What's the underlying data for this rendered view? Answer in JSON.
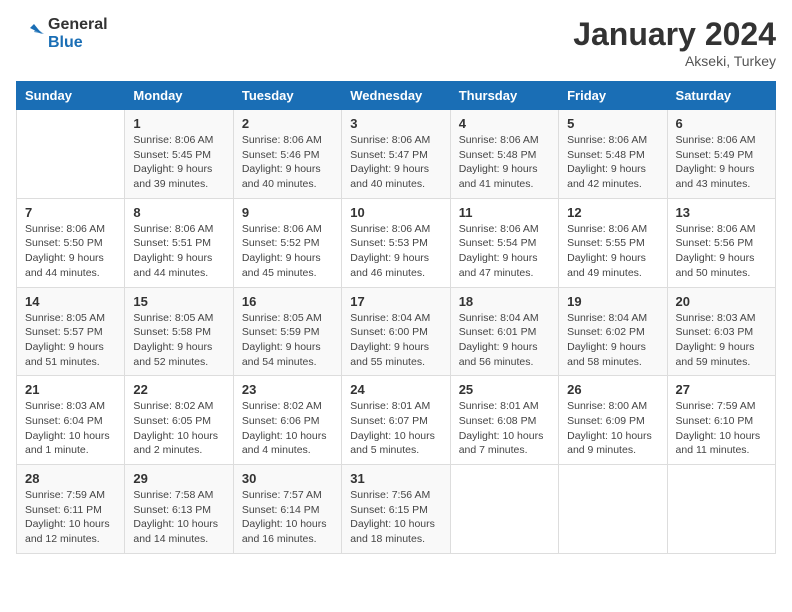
{
  "header": {
    "logo_line1": "General",
    "logo_line2": "Blue",
    "main_title": "January 2024",
    "subtitle": "Akseki, Turkey"
  },
  "days_of_week": [
    "Sunday",
    "Monday",
    "Tuesday",
    "Wednesday",
    "Thursday",
    "Friday",
    "Saturday"
  ],
  "weeks": [
    [
      {
        "day": "",
        "info": ""
      },
      {
        "day": "1",
        "info": "Sunrise: 8:06 AM\nSunset: 5:45 PM\nDaylight: 9 hours\nand 39 minutes."
      },
      {
        "day": "2",
        "info": "Sunrise: 8:06 AM\nSunset: 5:46 PM\nDaylight: 9 hours\nand 40 minutes."
      },
      {
        "day": "3",
        "info": "Sunrise: 8:06 AM\nSunset: 5:47 PM\nDaylight: 9 hours\nand 40 minutes."
      },
      {
        "day": "4",
        "info": "Sunrise: 8:06 AM\nSunset: 5:48 PM\nDaylight: 9 hours\nand 41 minutes."
      },
      {
        "day": "5",
        "info": "Sunrise: 8:06 AM\nSunset: 5:48 PM\nDaylight: 9 hours\nand 42 minutes."
      },
      {
        "day": "6",
        "info": "Sunrise: 8:06 AM\nSunset: 5:49 PM\nDaylight: 9 hours\nand 43 minutes."
      }
    ],
    [
      {
        "day": "7",
        "info": "Sunrise: 8:06 AM\nSunset: 5:50 PM\nDaylight: 9 hours\nand 44 minutes."
      },
      {
        "day": "8",
        "info": "Sunrise: 8:06 AM\nSunset: 5:51 PM\nDaylight: 9 hours\nand 44 minutes."
      },
      {
        "day": "9",
        "info": "Sunrise: 8:06 AM\nSunset: 5:52 PM\nDaylight: 9 hours\nand 45 minutes."
      },
      {
        "day": "10",
        "info": "Sunrise: 8:06 AM\nSunset: 5:53 PM\nDaylight: 9 hours\nand 46 minutes."
      },
      {
        "day": "11",
        "info": "Sunrise: 8:06 AM\nSunset: 5:54 PM\nDaylight: 9 hours\nand 47 minutes."
      },
      {
        "day": "12",
        "info": "Sunrise: 8:06 AM\nSunset: 5:55 PM\nDaylight: 9 hours\nand 49 minutes."
      },
      {
        "day": "13",
        "info": "Sunrise: 8:06 AM\nSunset: 5:56 PM\nDaylight: 9 hours\nand 50 minutes."
      }
    ],
    [
      {
        "day": "14",
        "info": "Sunrise: 8:05 AM\nSunset: 5:57 PM\nDaylight: 9 hours\nand 51 minutes."
      },
      {
        "day": "15",
        "info": "Sunrise: 8:05 AM\nSunset: 5:58 PM\nDaylight: 9 hours\nand 52 minutes."
      },
      {
        "day": "16",
        "info": "Sunrise: 8:05 AM\nSunset: 5:59 PM\nDaylight: 9 hours\nand 54 minutes."
      },
      {
        "day": "17",
        "info": "Sunrise: 8:04 AM\nSunset: 6:00 PM\nDaylight: 9 hours\nand 55 minutes."
      },
      {
        "day": "18",
        "info": "Sunrise: 8:04 AM\nSunset: 6:01 PM\nDaylight: 9 hours\nand 56 minutes."
      },
      {
        "day": "19",
        "info": "Sunrise: 8:04 AM\nSunset: 6:02 PM\nDaylight: 9 hours\nand 58 minutes."
      },
      {
        "day": "20",
        "info": "Sunrise: 8:03 AM\nSunset: 6:03 PM\nDaylight: 9 hours\nand 59 minutes."
      }
    ],
    [
      {
        "day": "21",
        "info": "Sunrise: 8:03 AM\nSunset: 6:04 PM\nDaylight: 10 hours\nand 1 minute."
      },
      {
        "day": "22",
        "info": "Sunrise: 8:02 AM\nSunset: 6:05 PM\nDaylight: 10 hours\nand 2 minutes."
      },
      {
        "day": "23",
        "info": "Sunrise: 8:02 AM\nSunset: 6:06 PM\nDaylight: 10 hours\nand 4 minutes."
      },
      {
        "day": "24",
        "info": "Sunrise: 8:01 AM\nSunset: 6:07 PM\nDaylight: 10 hours\nand 5 minutes."
      },
      {
        "day": "25",
        "info": "Sunrise: 8:01 AM\nSunset: 6:08 PM\nDaylight: 10 hours\nand 7 minutes."
      },
      {
        "day": "26",
        "info": "Sunrise: 8:00 AM\nSunset: 6:09 PM\nDaylight: 10 hours\nand 9 minutes."
      },
      {
        "day": "27",
        "info": "Sunrise: 7:59 AM\nSunset: 6:10 PM\nDaylight: 10 hours\nand 11 minutes."
      }
    ],
    [
      {
        "day": "28",
        "info": "Sunrise: 7:59 AM\nSunset: 6:11 PM\nDaylight: 10 hours\nand 12 minutes."
      },
      {
        "day": "29",
        "info": "Sunrise: 7:58 AM\nSunset: 6:13 PM\nDaylight: 10 hours\nand 14 minutes."
      },
      {
        "day": "30",
        "info": "Sunrise: 7:57 AM\nSunset: 6:14 PM\nDaylight: 10 hours\nand 16 minutes."
      },
      {
        "day": "31",
        "info": "Sunrise: 7:56 AM\nSunset: 6:15 PM\nDaylight: 10 hours\nand 18 minutes."
      },
      {
        "day": "",
        "info": ""
      },
      {
        "day": "",
        "info": ""
      },
      {
        "day": "",
        "info": ""
      }
    ]
  ]
}
